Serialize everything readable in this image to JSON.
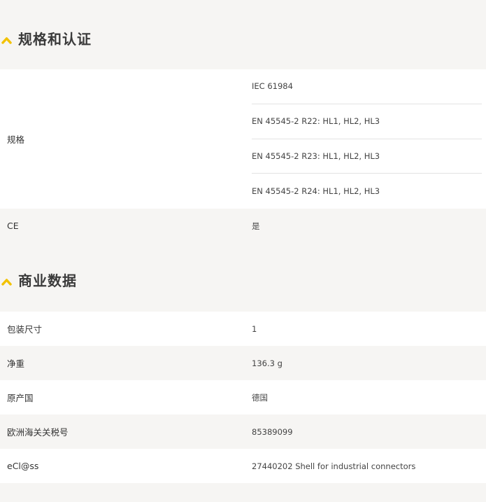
{
  "sections": [
    {
      "title": "规格和认证",
      "rows": [
        {
          "label": "规格",
          "values": [
            "IEC 61984",
            "EN 45545-2 R22: HL1, HL2, HL3",
            "EN 45545-2 R23: HL1, HL2, HL3",
            "EN 45545-2 R24: HL1, HL2, HL3"
          ]
        },
        {
          "label": "CE",
          "value": "是"
        }
      ]
    },
    {
      "title": "商业数据",
      "rows": [
        {
          "label": "包装尺寸",
          "value": "1"
        },
        {
          "label": "净重",
          "value": "136.3 g"
        },
        {
          "label": "原产国",
          "value": "德国"
        },
        {
          "label": "欧洲海关关税号",
          "value": "85389099"
        },
        {
          "label": "eCl@ss",
          "value": "27440202 Shell for industrial connectors"
        }
      ]
    }
  ],
  "colors": {
    "accent": "#f2c200",
    "row_white": "#ffffff",
    "row_grey": "#f6f5f3"
  },
  "icons": {
    "section_toggle": "chevron-up-icon"
  }
}
